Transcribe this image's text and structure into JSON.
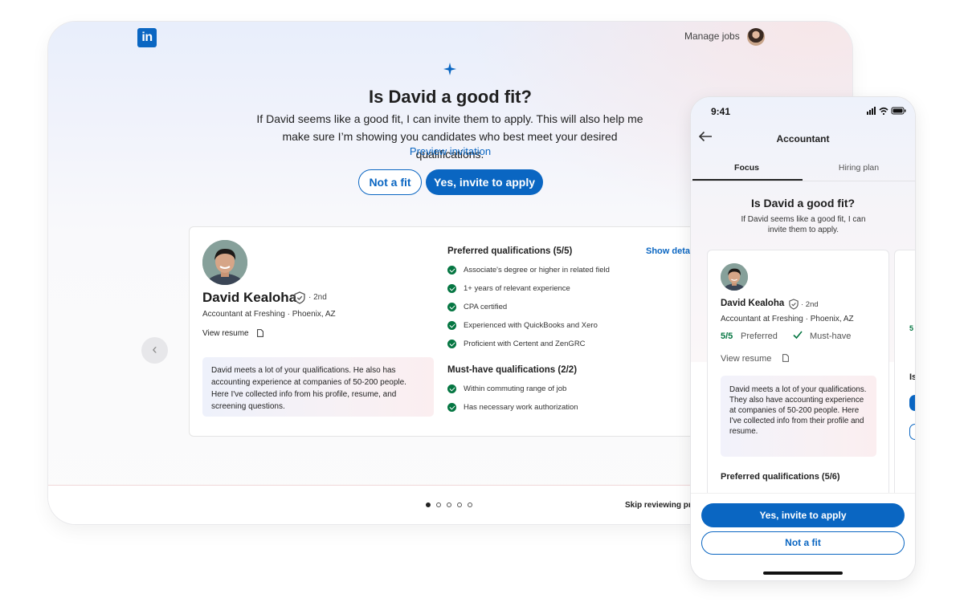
{
  "desktop": {
    "logo_text": "in",
    "nav": {
      "manage_jobs": "Manage jobs"
    },
    "title": "Is David a good fit?",
    "description": "If David seems like a good fit, I can invite them to apply. This will also help me make sure I’m showing you candidates who best meet your desired qualifications.",
    "preview_link": "Preview invitation",
    "buttons": {
      "not_fit": "Not a fit",
      "invite": "Yes, invite to apply"
    },
    "candidate": {
      "name": "David Kealoha",
      "degree": "· 2nd",
      "role": "Accountant at Freshing · Phoenix, AZ",
      "view_resume": "View resume",
      "summary": "David meets a lot of your qualifications. He also has accounting experience at companies of 50-200 people. Here I've collected info from his profile, resume, and screening questions."
    },
    "preferred": {
      "heading": "Preferred qualifications (5/5)",
      "show_details": "Show details",
      "items": [
        "Associate's degree or higher in related field",
        "1+ years of relevant experience",
        "CPA certified",
        "Experienced with QuickBooks and Xero",
        "Proficient with Certent and ZenGRC"
      ]
    },
    "must_have": {
      "heading": "Must-have qualifications (2/2)",
      "items": [
        "Within commuting range of job",
        "Has necessary work authorization"
      ]
    },
    "footer": {
      "pages": 5,
      "active_page": 1,
      "skip": "Skip reviewing pro"
    }
  },
  "phone": {
    "time": "9:41",
    "title": "Accountant",
    "tabs": [
      "Focus",
      "Hiring plan"
    ],
    "active_tab": "Focus",
    "question": "Is David a good fit?",
    "description": "If David seems like a good fit, I can invite them to apply.",
    "candidate": {
      "name": "David Kealoha",
      "degree": "· 2nd",
      "role": "Accountant at Freshing · Phoenix, AZ",
      "score": "5/5",
      "preferred_label": "Preferred",
      "must_label": "Must-have",
      "view_resume": "View resume",
      "summary": "David meets a lot of your qualifications. They also have accounting experience at companies of 50-200 people. Here I've collected info from their profile and resume.",
      "qual_heading": "Preferred qualifications (5/6)"
    },
    "peek_card": {
      "score": "5",
      "heading_initial": "Is"
    },
    "buttons": {
      "invite": "Yes, invite to apply",
      "not_fit": "Not a fit"
    }
  },
  "colors": {
    "brand": "#0a66c2",
    "success": "#057642"
  },
  "icons": [
    "sparkle-icon",
    "verified-shield-icon",
    "document-icon",
    "chevron-left-icon",
    "back-arrow-icon",
    "checkmark-icon"
  ]
}
